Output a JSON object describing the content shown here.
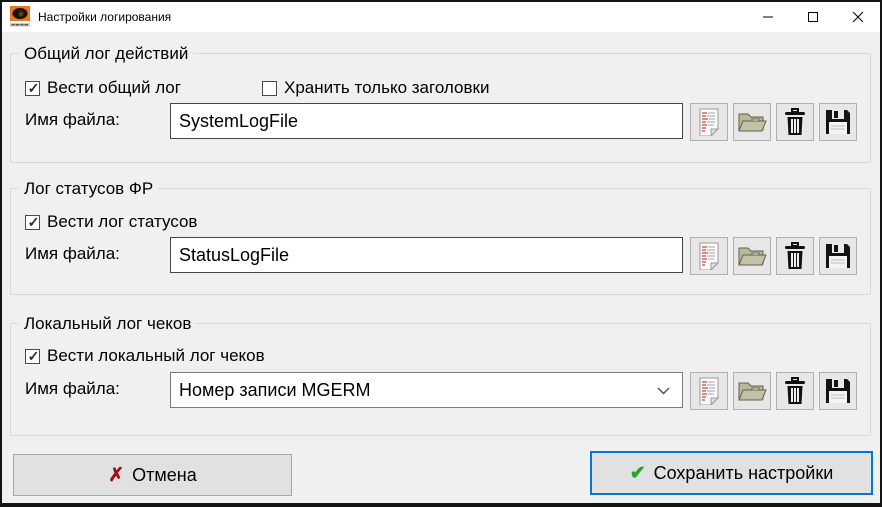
{
  "window": {
    "title": "Настройки логирования"
  },
  "sections": [
    {
      "title": "Общий лог действий",
      "checkboxes": [
        {
          "label": "Вести общий лог",
          "checked": true
        },
        {
          "label": "Хранить только заголовки",
          "checked": false
        }
      ],
      "file_label": "Имя файла:",
      "file_value": "SystemLogFile",
      "field_type": "text"
    },
    {
      "title": "Лог статусов ФР",
      "checkboxes": [
        {
          "label": "Вести лог статусов",
          "checked": true
        }
      ],
      "file_label": "Имя файла:",
      "file_value": "StatusLogFile",
      "field_type": "text"
    },
    {
      "title": "Локальный лог чеков",
      "checkboxes": [
        {
          "label": "Вести локальный лог чеков",
          "checked": true
        }
      ],
      "file_label": "Имя файла:",
      "file_value": "Номер записи MGERM",
      "field_type": "combobox"
    }
  ],
  "footer": {
    "cancel_label": "Отмена",
    "save_label": "Сохранить настройки"
  },
  "icons": {
    "app_icon": "orange-eye-logo",
    "row_buttons": [
      "view-log-icon",
      "open-folder-icon",
      "trash-icon",
      "floppy-save-icon"
    ],
    "window_buttons": [
      "minimize-icon",
      "maximize-icon",
      "close-icon"
    ],
    "cancel_glyph": "✗",
    "save_glyph": "✔",
    "combo_glyph": "chevron-down-icon"
  },
  "colors": {
    "accent_blue": "#0078d7",
    "cancel_red": "#9e101b",
    "save_green": "#27a327",
    "folder_olive": "#b9b89c",
    "titlebar_bg": "#ffffff",
    "client_bg": "#f0f0f0"
  }
}
